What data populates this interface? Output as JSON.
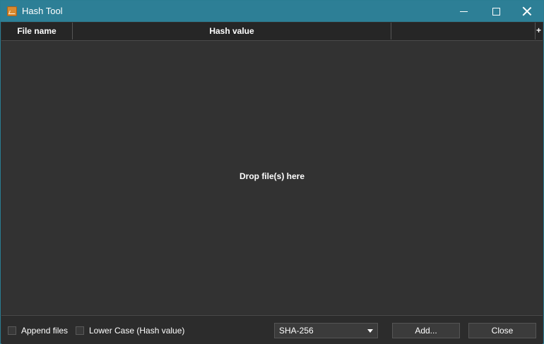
{
  "window": {
    "title": "Hash Tool",
    "icon": "app-icon",
    "controls": [
      "minimize-icon",
      "maximize-icon",
      "close-icon"
    ]
  },
  "table": {
    "columns": [
      "File name",
      "Hash value",
      ""
    ],
    "add_column_symbol": "+"
  },
  "drop_area": {
    "text": "Drop file(s) here"
  },
  "bottom": {
    "append_files": {
      "label": "Append files",
      "checked": false
    },
    "lower_case": {
      "label": "Lower Case (Hash value)",
      "checked": false
    },
    "algorithm": {
      "selected": "SHA-256"
    },
    "add_label": "Add...",
    "close_label": "Close"
  },
  "colors": {
    "titlebar": "#2d7f96",
    "background": "#323232",
    "text": "#ffffff"
  }
}
